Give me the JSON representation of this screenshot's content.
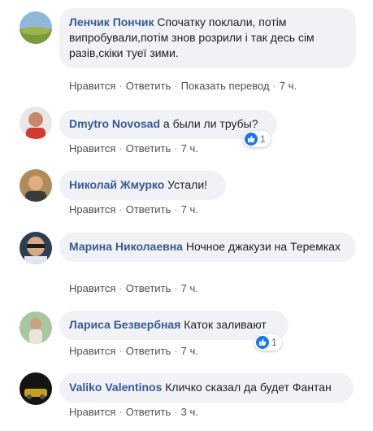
{
  "actions": {
    "like": "Нравится",
    "reply": "Ответить",
    "translate": "Показать перевод"
  },
  "comments": [
    {
      "author": "Ленчик Пончик",
      "text": "Спочатку поклали, потім випробували,потім знов розрили і так десь сім разів,скіки туеї зими.",
      "time": "7 ч."
    },
    {
      "author": "Dmytro Novosad",
      "text": "а были ли трубы?",
      "time": "7 ч.",
      "reactions": "1"
    },
    {
      "author": "Николай Жмурко",
      "text": "Устали!",
      "time": "7 ч."
    },
    {
      "author": "Марина Николаевна",
      "text": "Ночное джакузи на Теремках",
      "time": "7 ч."
    },
    {
      "author": "Лариса Безвербная",
      "text": "Каток заливают",
      "time": "7 ч.",
      "reactions": "1"
    },
    {
      "author": "Valiko Valentinos",
      "text": "Кличко сказал да будет Фантан",
      "time": "3 ч."
    }
  ],
  "colors": {
    "author": "#385898",
    "bubble": "#f0f2f5",
    "like_blue": "#1877f2"
  }
}
